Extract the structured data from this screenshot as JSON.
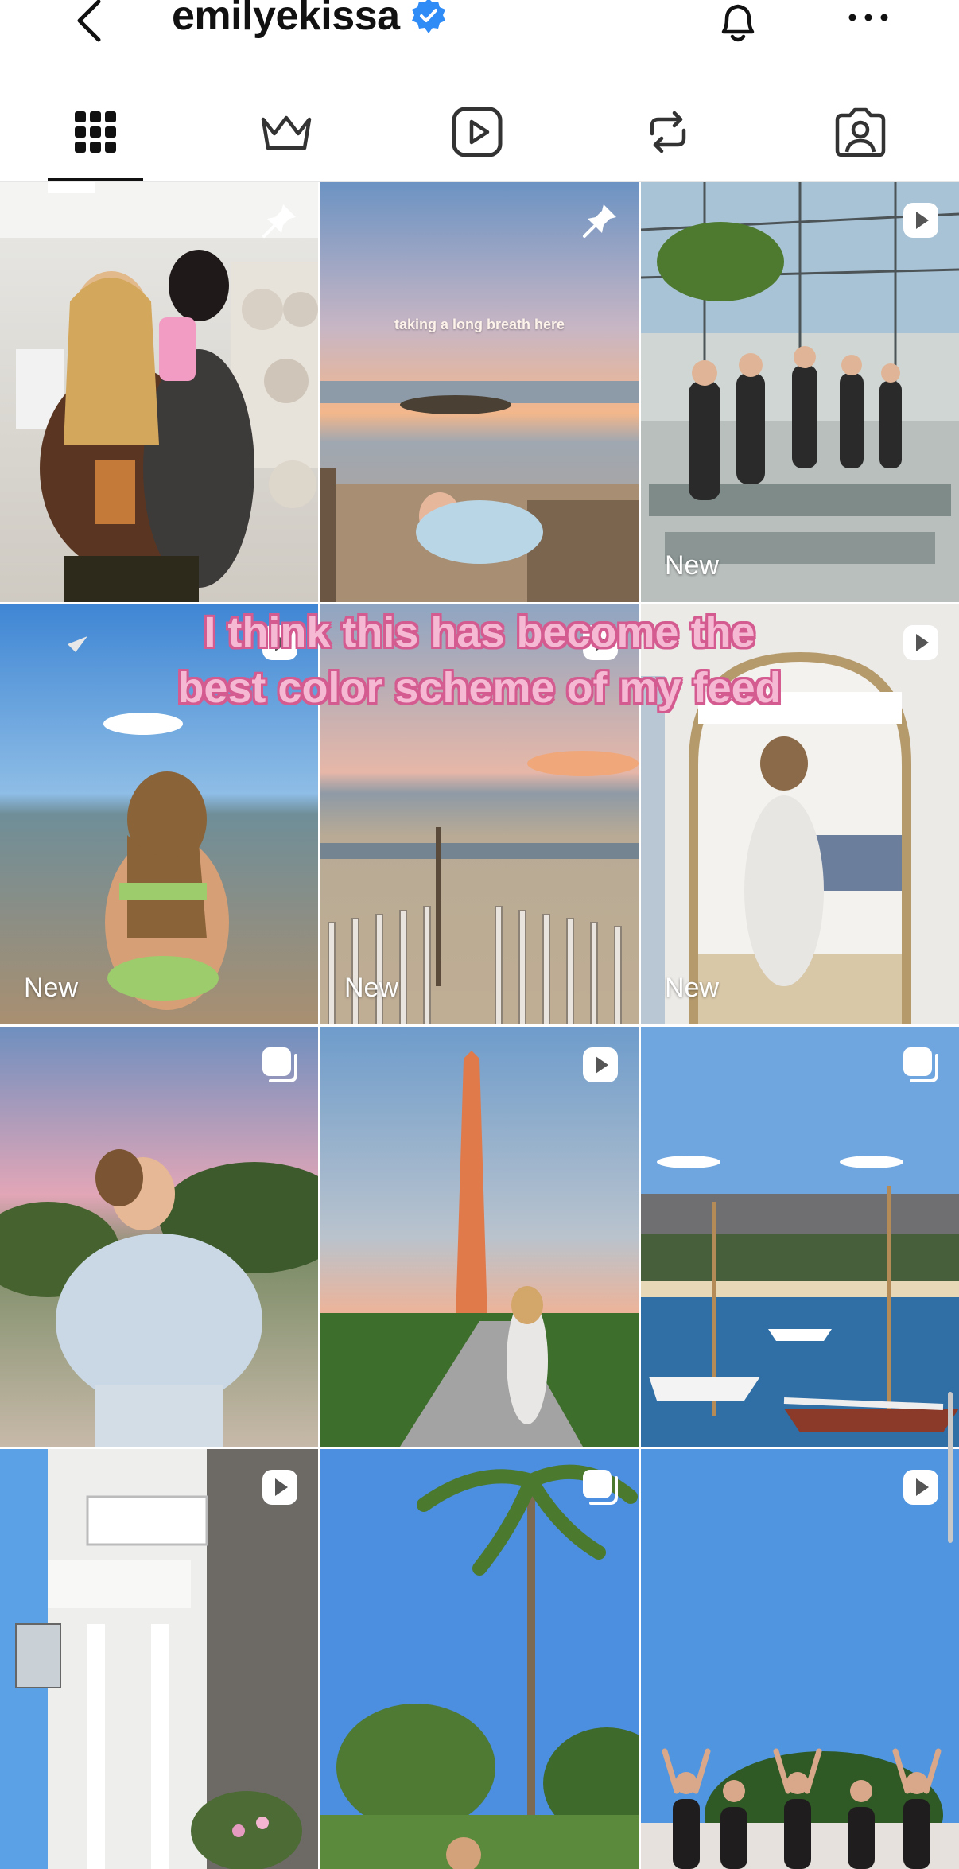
{
  "header": {
    "username": "emilyekissa",
    "verified": true
  },
  "tabs": [
    {
      "name": "posts-grid",
      "active": true
    },
    {
      "name": "subscriptions"
    },
    {
      "name": "reels"
    },
    {
      "name": "reposts"
    },
    {
      "name": "tagged"
    }
  ],
  "grid": {
    "posts": [
      {
        "name": "mirror-selfie-couple",
        "badge": "pin-icon",
        "label": ""
      },
      {
        "name": "beach-sunset",
        "badge": "pin-icon",
        "label": "",
        "photo_text": "taking a long breath here"
      },
      {
        "name": "yoga-class",
        "badge": "reel-icon",
        "label": "New"
      },
      {
        "name": "beach-bikini",
        "badge": "reel-icon",
        "label": "New"
      },
      {
        "name": "beach-fence",
        "badge": "reel-icon",
        "label": "New"
      },
      {
        "name": "mirror-selfie-bedroom",
        "badge": "reel-icon",
        "label": "New"
      },
      {
        "name": "sweatshirt-beach",
        "badge": "carousel-icon",
        "label": ""
      },
      {
        "name": "washington-monument",
        "badge": "reel-icon",
        "label": ""
      },
      {
        "name": "harbor-sailboats",
        "badge": "carousel-icon",
        "label": ""
      },
      {
        "name": "cliff-lodge",
        "badge": "reel-icon",
        "label": ""
      },
      {
        "name": "palm-trees",
        "badge": "carousel-icon",
        "label": ""
      },
      {
        "name": "outdoor-yoga",
        "badge": "reel-icon",
        "label": ""
      }
    ]
  },
  "caption": {
    "text": "I think this has become the best color scheme of my feed"
  },
  "colors": {
    "verified_blue": "#2f8bf5",
    "caption_fill": "#f6b9d4",
    "caption_stroke": "#d45b90"
  }
}
